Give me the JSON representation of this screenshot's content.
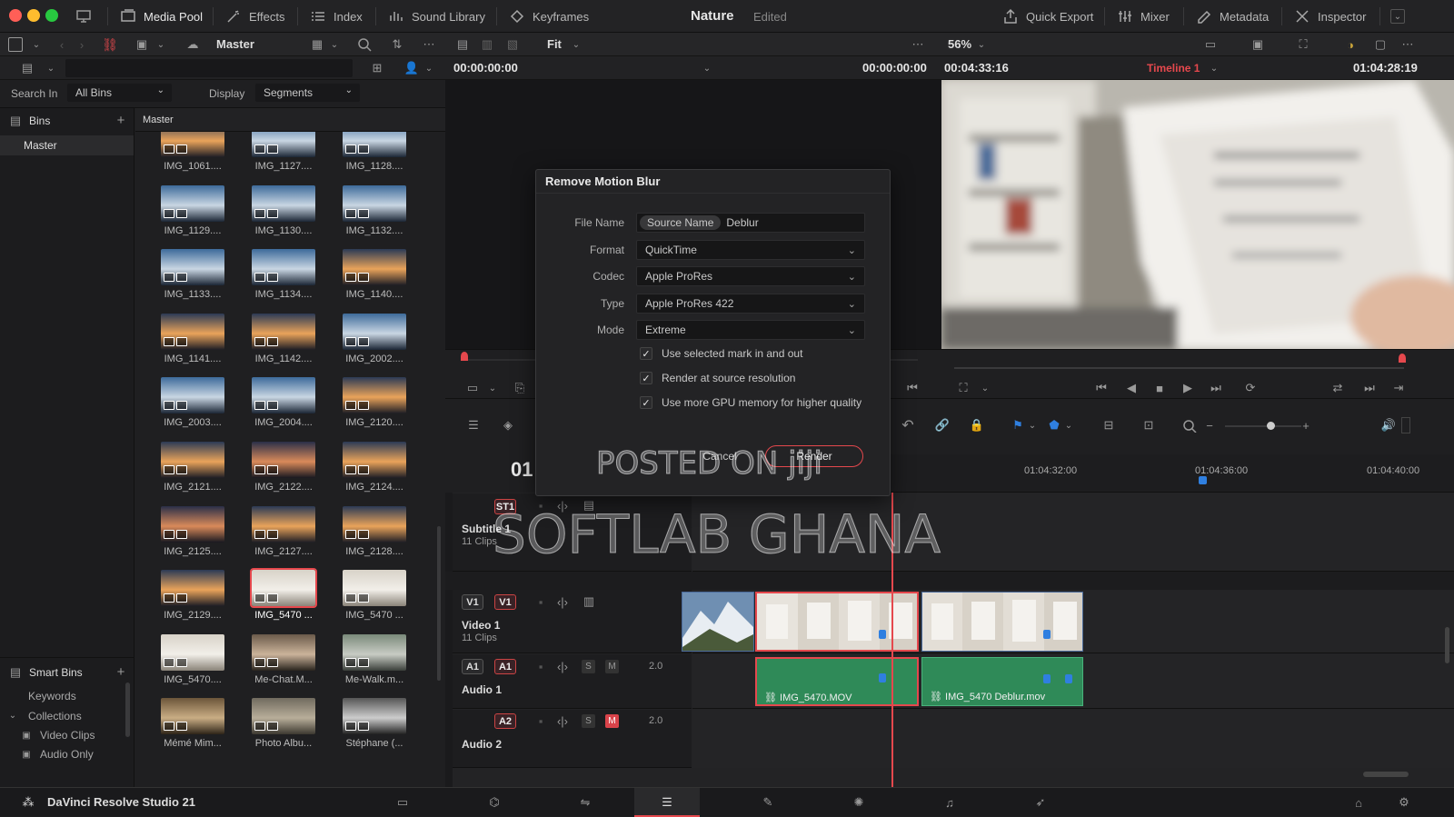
{
  "colors": {
    "accent_red": "#e5484d",
    "audio_green": "#2f8a58",
    "marker_blue": "#2f7fe0"
  },
  "topbar": {
    "media_pool": "Media Pool",
    "effects": "Effects",
    "index": "Index",
    "sound_library": "Sound Library",
    "keyframes": "Keyframes",
    "project_title": "Nature",
    "project_status": "Edited",
    "quick_export": "Quick Export",
    "mixer": "Mixer",
    "metadata": "Metadata",
    "inspector": "Inspector"
  },
  "toolbar": {
    "bin_title": "Master",
    "fit": "Fit",
    "zoom": "56%",
    "source_timecode": "00:00:00:00",
    "source_timecode_right": "00:00:00:00",
    "duration": "00:04:33:16",
    "timeline_name": "Timeline 1",
    "record_timecode": "01:04:28:19"
  },
  "mediapool": {
    "search_in_label": "Search In",
    "search_in_value": "All Bins",
    "display_label": "Display",
    "display_value": "Segments",
    "bins_label": "Bins",
    "master_bin": "Master",
    "grid_header": "Master",
    "smart_bins": "Smart Bins",
    "keywords": "Keywords",
    "collections": "Collections",
    "video_clips": "Video Clips",
    "audio_only": "Audio Only",
    "clips": [
      {
        "label": "IMG_1061....",
        "kind": "sunset"
      },
      {
        "label": "IMG_1127....",
        "kind": "blue"
      },
      {
        "label": "IMG_1128....",
        "kind": "blue"
      },
      {
        "label": "IMG_1129....",
        "kind": "blue"
      },
      {
        "label": "IMG_1130....",
        "kind": "blue"
      },
      {
        "label": "IMG_1132....",
        "kind": "blue"
      },
      {
        "label": "IMG_1133....",
        "kind": "blue"
      },
      {
        "label": "IMG_1134....",
        "kind": "blue"
      },
      {
        "label": "IMG_1140....",
        "kind": "sunset"
      },
      {
        "label": "IMG_1141....",
        "kind": "sunset"
      },
      {
        "label": "IMG_1142....",
        "kind": "sunset"
      },
      {
        "label": "IMG_2002....",
        "kind": "blue"
      },
      {
        "label": "IMG_2003....",
        "kind": "blue"
      },
      {
        "label": "IMG_2004....",
        "kind": "blue"
      },
      {
        "label": "IMG_2120....",
        "kind": "sunset"
      },
      {
        "label": "IMG_2121....",
        "kind": "sunset"
      },
      {
        "label": "IMG_2122....",
        "kind": "dusk"
      },
      {
        "label": "IMG_2124....",
        "kind": "sunset"
      },
      {
        "label": "IMG_2125....",
        "kind": "dusk"
      },
      {
        "label": "IMG_2127....",
        "kind": "sunset"
      },
      {
        "label": "IMG_2128....",
        "kind": "sunset"
      },
      {
        "label": "IMG_2129....",
        "kind": "sunset"
      },
      {
        "label": "IMG_5470 ...",
        "kind": "paper",
        "selected": true
      },
      {
        "label": "IMG_5470 ...",
        "kind": "paper"
      },
      {
        "label": "IMG_5470....",
        "kind": "paper"
      },
      {
        "label": "Me-Chat.M...",
        "kind": "person"
      },
      {
        "label": "Me-Walk.m...",
        "kind": "street"
      },
      {
        "label": "Mémé Mim...",
        "kind": "sepia"
      },
      {
        "label": "Photo Albu...",
        "kind": "album"
      },
      {
        "label": "Stéphane (...",
        "kind": "bw"
      }
    ]
  },
  "dialog": {
    "title": "Remove Motion Blur",
    "file_name_label": "File Name",
    "file_name_token": "Source Name",
    "file_name_suffix": "Deblur",
    "format_label": "Format",
    "format_value": "QuickTime",
    "codec_label": "Codec",
    "codec_value": "Apple ProRes",
    "type_label": "Type",
    "type_value": "Apple ProRes 422",
    "mode_label": "Mode",
    "mode_value": "Extreme",
    "check1": "Use selected mark in and out",
    "check2": "Render at source resolution",
    "check3": "Use more GPU memory for higher quality",
    "cancel": "Cancel",
    "render": "Render"
  },
  "timeline": {
    "timecode_partial": "01",
    "ruler": [
      "01:04:32:00",
      "01:04:36:00",
      "01:04:40:00"
    ],
    "subtitle_track": {
      "tag": "ST1",
      "name": "Subtitle 1",
      "count": "11 Clips"
    },
    "video_track": {
      "tag": "V1",
      "name": "Video 1",
      "count": "11 Clips"
    },
    "audio1": {
      "tag": "A1",
      "name": "Audio 1",
      "level": "2.0"
    },
    "audio2": {
      "tag": "A2",
      "name": "Audio 2",
      "level": "2.0"
    },
    "solo": "S",
    "mute": "M",
    "audio_clips": [
      "IMG_5470.MOV",
      "IMG_5470 Deblur.mov"
    ]
  },
  "bottombar": {
    "app_name": "DaVinci Resolve Studio 21"
  },
  "watermarks": {
    "line1": "POSTED ON jiji",
    "line2": "SOFTLAB GHANA"
  }
}
